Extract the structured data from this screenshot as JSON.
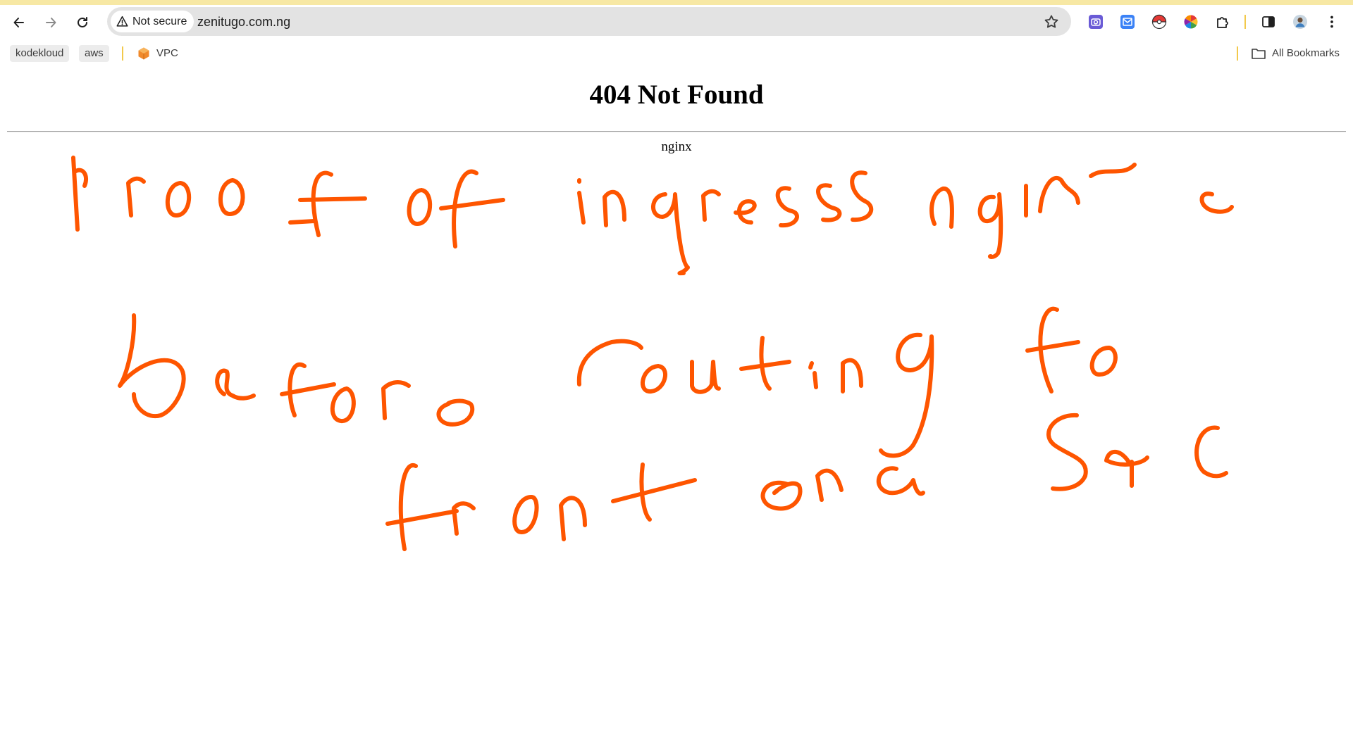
{
  "browser": {
    "security_label": "Not secure",
    "url": "zenitugo.com.ng",
    "accent_color": "#f7e8a4",
    "nav_icons": [
      "back-arrow-icon",
      "forward-arrow-icon",
      "reload-icon"
    ],
    "extension_icons": [
      "camera-extension-icon",
      "mail-extension-icon",
      "pokeball-extension-icon",
      "color-wheel-extension-icon",
      "puzzle-extensions-icon"
    ],
    "right_icons": [
      "side-panel-icon",
      "profile-avatar",
      "kebab-menu-icon"
    ]
  },
  "bookmarks": {
    "items": [
      {
        "label": "kodekloud"
      },
      {
        "label": "aws"
      },
      {
        "label": "VPC",
        "icon": "aws-vpc-icon"
      }
    ],
    "all_bookmarks_label": "All Bookmarks"
  },
  "page": {
    "title": "404 Not Found",
    "server": "nginx"
  },
  "annotation": {
    "color": "#fe5500",
    "text": "proof of ingress nginx before routing to front end svc"
  }
}
